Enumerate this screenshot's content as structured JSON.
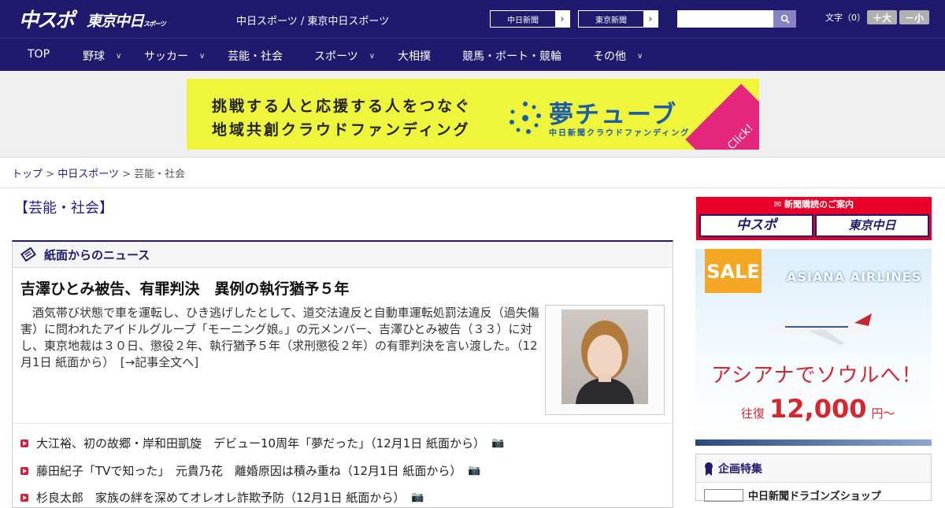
{
  "header": {
    "logo_main": "中スポ",
    "logo_tokyo": "東京中日",
    "logo_tokyo_small": "スポーツ",
    "site_title": "中日スポーツ / 東京中日スポーツ",
    "paper_buttons": [
      "中日新聞",
      "東京新聞"
    ],
    "search_placeholder": "",
    "font_size_label": "文字（0）",
    "font_bigger": "＋大",
    "font_smaller": "－小"
  },
  "nav": {
    "items": [
      {
        "label": "TOP",
        "has_menu": false
      },
      {
        "label": "野球",
        "has_menu": true
      },
      {
        "label": "サッカー",
        "has_menu": true
      },
      {
        "label": "芸能・社会",
        "has_menu": false
      },
      {
        "label": "スポーツ",
        "has_menu": true
      },
      {
        "label": "大相撲",
        "has_menu": false
      },
      {
        "label": "競馬・ボート・競輪",
        "has_menu": false
      },
      {
        "label": "その他",
        "has_menu": true
      }
    ]
  },
  "banner_ad": {
    "line1": "挑戦する人と応援する人をつなぐ",
    "line2": "地域共創クラウドファンディング",
    "brand": "夢チューブ",
    "brand_sub": "中日新聞クラウドファンディング",
    "cta": "Click!",
    "colors": {
      "bg": "#eef53a",
      "brand": "#1c5ca8",
      "cta": "#e5267d"
    }
  },
  "breadcrumb": {
    "home": "トップ",
    "sep": ">",
    "section": "中日スポーツ",
    "current": "芸能・社会"
  },
  "section_title": "【芸能・社会】",
  "news_box": {
    "header": "紙面からのニュース",
    "lead": {
      "title": "吉澤ひとみ被告、有罪判決　異例の執行猶予５年",
      "text": "酒気帯び状態で車を運転し、ひき逃げしたとして、道交法違反と自動車運転処罰法違反（過失傷害）に問われたアイドルグループ「モーニング娘。」の元メンバー、吉澤ひとみ被告（３３）に対し、東京地裁は３０日、懲役２年、執行猶予５年（求刑懲役２年）の有罪判決を言い渡した。（12月1日 紙面から）　[→記事全文へ]"
    },
    "items": [
      "大江裕、初の故郷・岸和田凱旋　デビュー10周年「夢だった」（12月1日 紙面から）",
      "藤田紀子「TVで知った」　元貴乃花　離婚原因は積み重ね（12月1日 紙面から）",
      "杉良太郎　家族の絆を深めてオレオレ詐欺予防（12月1日 紙面から）"
    ]
  },
  "sidebar": {
    "subscribe_header": "新聞購読のご案内",
    "subscribe_buttons": [
      "中スポ",
      "東京中日"
    ],
    "airline_ad": {
      "sale": "SALE",
      "airline": "ASIANA AIRLINES",
      "copy": "アシアナでソウルへ！",
      "price_prefix": "往復",
      "price": "12,000",
      "price_suffix": "円～",
      "colors": {
        "sale": "#f5a623",
        "copy": "#d6262e"
      }
    },
    "feature_header": "企画特集",
    "feature_item": "中日新聞ドラゴンズショップ"
  },
  "colors": {
    "brand_navy": "#1f1a6e",
    "accent_red": "#d81f3a"
  }
}
